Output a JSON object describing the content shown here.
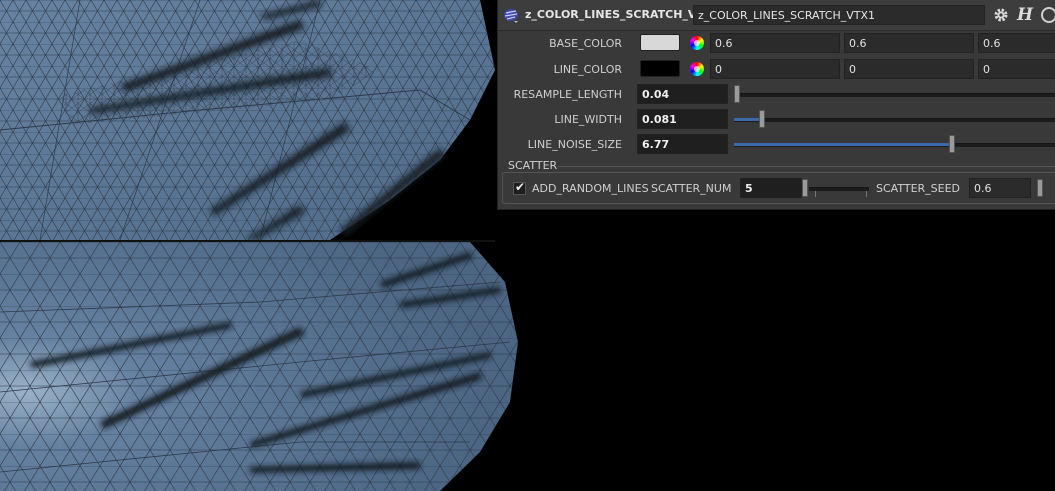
{
  "node": {
    "type_label": "z_COLOR_LINES_SCRATCH_VTX",
    "name": "z_COLOR_LINES_SCRATCH_VTX1"
  },
  "header_icons": [
    "node-type-icon",
    "gear-icon",
    "help-icon",
    "info-icon"
  ],
  "help_glyph": "H",
  "parms": {
    "base_color": {
      "label": "BASE_COLOR",
      "swatch": "#d8d8d8",
      "values": [
        "0.6",
        "0.6",
        "0.6"
      ]
    },
    "line_color": {
      "label": "LINE_COLOR",
      "swatch": "#000000",
      "values": [
        "0",
        "0",
        "0"
      ]
    },
    "resample_length": {
      "label": "RESAMPLE_LENGTH",
      "value": "0.04",
      "slider_fraction": 0.0
    },
    "line_width": {
      "label": "LINE_WIDTH",
      "value": "0.081",
      "slider_fraction": 0.08
    },
    "line_noise_size": {
      "label": "LINE_NOISE_SIZE",
      "value": "6.77",
      "slider_fraction": 0.68
    }
  },
  "scatter": {
    "folder_label": "SCATTER",
    "add_random_lines": {
      "label": "ADD_RANDOM_LINES",
      "checked": true,
      "check_glyph": "✔"
    },
    "scatter_num": {
      "label": "SCATTER_NUM",
      "value": "5"
    },
    "scatter_seed": {
      "label": "SCATTER_SEED",
      "value": "0.6"
    }
  },
  "colors": {
    "surface": "#5b7694",
    "wire": "#2a3644",
    "scratch": "#141a22",
    "panel_bg": "#393939",
    "slider_fill": "#3a6aa8"
  }
}
